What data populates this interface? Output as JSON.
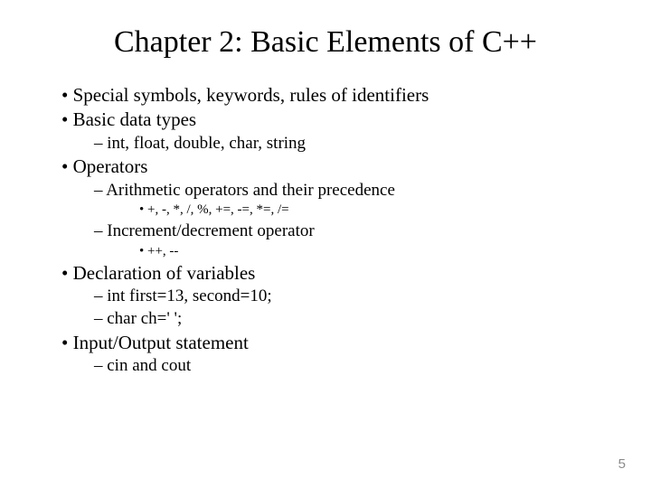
{
  "title": "Chapter 2: Basic Elements of C++",
  "bullets": {
    "b0": "Special symbols, keywords, rules of identifiers",
    "b1": "Basic data types",
    "b1_0": "int, float, double, char, string",
    "b2": "Operators",
    "b2_0": "Arithmetic operators and their precedence",
    "b2_0_0": "+, -, *, /, %, +=, -=, *=, /=",
    "b2_1": "Increment/decrement operator",
    "b2_1_0": "++, --",
    "b3": "Declaration of variables",
    "b3_0": "int first=13, second=10;",
    "b3_1": "char ch=' ';",
    "b4": "Input/Output statement",
    "b4_0": "cin and cout"
  },
  "page_number": "5"
}
